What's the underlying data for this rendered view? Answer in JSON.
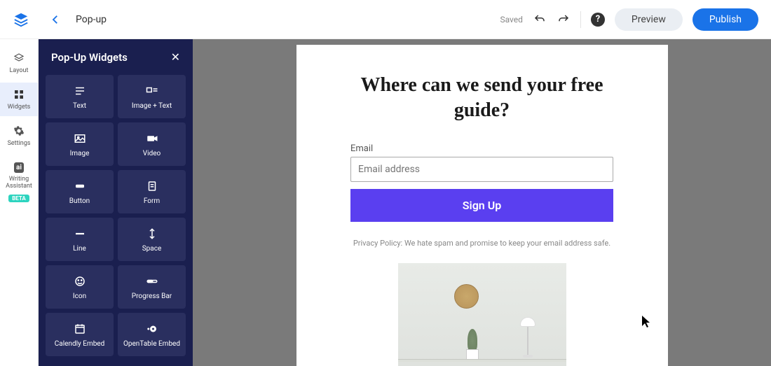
{
  "topbar": {
    "page_title": "Pop-up",
    "saved_label": "Saved",
    "preview_label": "Preview",
    "publish_label": "Publish"
  },
  "leftnav": {
    "items": [
      {
        "label": "Layout"
      },
      {
        "label": "Widgets"
      },
      {
        "label": "Settings"
      },
      {
        "label": "Writing Assistant"
      }
    ],
    "beta_label": "BETA"
  },
  "widgets_panel": {
    "title": "Pop-Up Widgets",
    "tiles": [
      {
        "label": "Text"
      },
      {
        "label": "Image + Text"
      },
      {
        "label": "Image"
      },
      {
        "label": "Video"
      },
      {
        "label": "Button"
      },
      {
        "label": "Form"
      },
      {
        "label": "Line"
      },
      {
        "label": "Space"
      },
      {
        "label": "Icon"
      },
      {
        "label": "Progress Bar"
      },
      {
        "label": "Calendly Embed"
      },
      {
        "label": "OpenTable Embed"
      }
    ]
  },
  "popup": {
    "heading": "Where can we send your free guide?",
    "email_label": "Email",
    "email_placeholder": "Email address",
    "signup_label": "Sign Up",
    "privacy_text": "Privacy Policy: We hate spam and promise to keep your email address safe."
  }
}
